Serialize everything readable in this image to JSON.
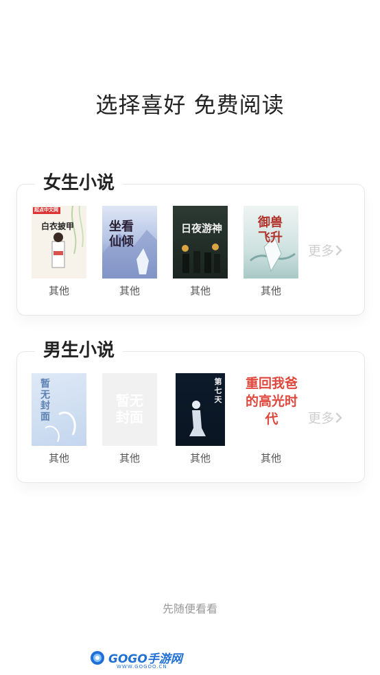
{
  "page": {
    "title": "选择喜好 免费阅读",
    "browse_label": "先随便看看"
  },
  "sections": [
    {
      "title": "女生小说",
      "more_label": "更多",
      "books": [
        {
          "label": "其他",
          "cover_text": "白衣披甲",
          "publisher": "起点中文网"
        },
        {
          "label": "其他",
          "cover_text": "坐看仙倾"
        },
        {
          "label": "其他",
          "cover_text": "日夜游神"
        },
        {
          "label": "其他",
          "cover_text": "御兽飞升"
        }
      ]
    },
    {
      "title": "男生小说",
      "more_label": "更多",
      "books": [
        {
          "label": "其他",
          "cover_text": "暂无封面"
        },
        {
          "label": "其他",
          "cover_text": "暂无封面"
        },
        {
          "label": "其他",
          "cover_text": "第七天"
        },
        {
          "label": "其他",
          "cover_text": "重回我爸的高光时代"
        }
      ]
    }
  ],
  "watermark": {
    "brand": "GOGO手游网",
    "url": "WWW.GOGOO.CN"
  },
  "colors": {
    "text_primary": "#222222",
    "text_muted": "#9a9a9a",
    "more_gray": "#cfcfcf",
    "card_border": "#e6e6e6",
    "watermark_blue": "#1f6fd6"
  }
}
